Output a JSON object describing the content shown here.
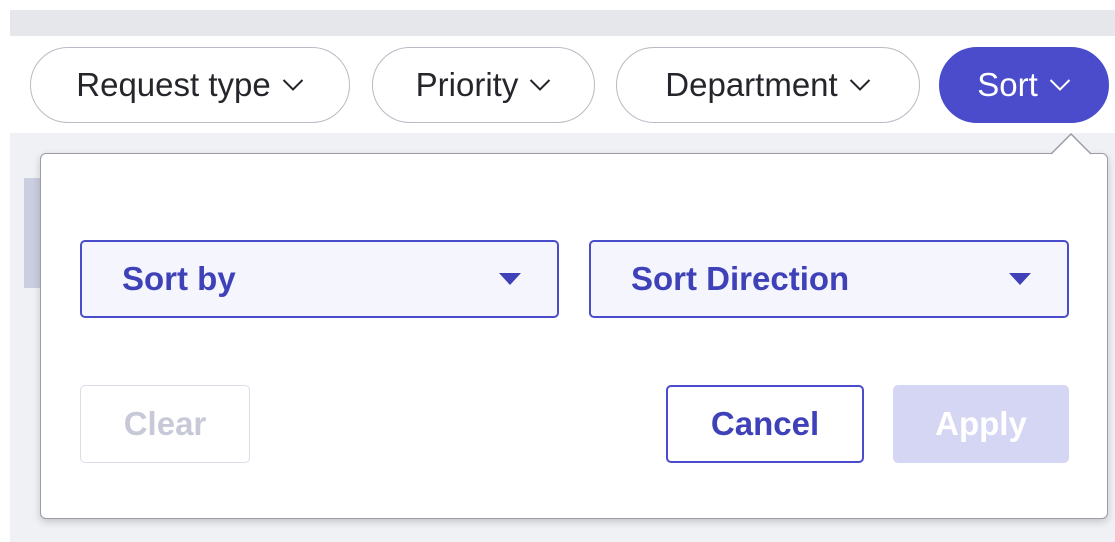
{
  "filters": {
    "chips": [
      {
        "label": "Request type",
        "active": false
      },
      {
        "label": "Priority",
        "active": false
      },
      {
        "label": "Department",
        "active": false
      },
      {
        "label": "Sort",
        "active": true
      }
    ]
  },
  "sort_popover": {
    "sort_by": {
      "label": "Sort by",
      "icon": "caret-down-icon"
    },
    "sort_direction": {
      "label": "Sort Direction",
      "icon": "caret-down-icon"
    },
    "actions": {
      "clear_label": "Clear",
      "cancel_label": "Cancel",
      "apply_label": "Apply"
    }
  },
  "colors": {
    "accent": "#4a4ccc",
    "accent_text": "#3f41b8",
    "disabled_bg": "#d5d6f3",
    "disabled_text": "#c8c9d8",
    "chip_border": "#b9bac4",
    "background_band": "#f0f1f5"
  },
  "icons": {
    "chip_chevron": "chevron-down-icon"
  }
}
